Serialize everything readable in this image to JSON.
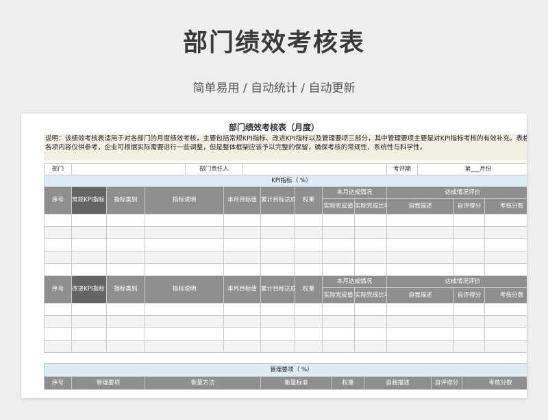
{
  "page": {
    "title": "部门绩效考核表",
    "subtitle": "简单易用  /  自动统计  /  自动更新"
  },
  "sheet": {
    "title": "部门绩效考核表（月度）",
    "description": "说明：该绩效考核表适用于对各部门的月度绩效考核，主要包括常规KPI指标、改进KPI指标以及管理要项三部分，其中管理要项主要是对KPI指标考核的有效补充。表格中各项内容仅供参考，企业可根据实际需要进行一些调整，但是整体框架应该予以完整的保留，确保考核的常规性、系统性与科学性。",
    "info": {
      "dept_label": "部门",
      "manager_label": "部门责任人",
      "period_label": "考评期",
      "period_value": "第___月份"
    },
    "kpi_section": "KPI指标（      %）",
    "kpi_table": {
      "seq": "序号",
      "regular_kpi": "常规KPI指标（ %）",
      "improve_kpi": "改进KPI指标（ %）",
      "category": "指标类别",
      "explain": "指标说明",
      "target": "本月目标值",
      "cum_rate": "累计目标达成比率",
      "weight": "权重",
      "month_group": "本月达成情况",
      "actual": "实际完成值",
      "actual_rate": "实际完成比率（%）",
      "eval_group": "达成情况评价",
      "self_desc": "自我描述",
      "self_score": "自评得分",
      "audit_score": "考核分数"
    },
    "mgmt_section": "管理要项（      %）",
    "mgmt_table": {
      "seq": "序号",
      "item": "管理要项",
      "method": "衡量方法",
      "standard": "衡量标准",
      "weight": "权重",
      "self_desc": "自我描述",
      "self_score": "自评得分",
      "audit_score": "考核分数"
    }
  }
}
